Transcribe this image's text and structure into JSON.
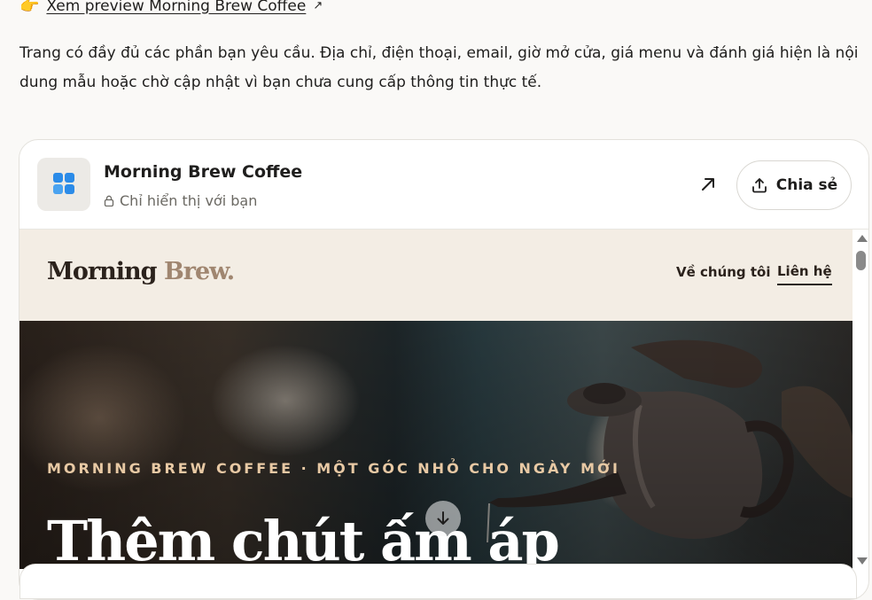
{
  "top_link": {
    "emoji": "👉",
    "text": "Xem preview Morning Brew Coffee",
    "ext_icon": "↗"
  },
  "intro": "Trang có đầy đủ các phần bạn yêu cầu. Địa chỉ, điện thoại, email, giờ mở cửa, giá menu và đánh giá hiện là nội dung mẫu hoặc chờ cập nhật vì bạn chưa cung cấp thông tin thực tế.",
  "artifact": {
    "title": "Morning Brew Coffee",
    "visibility": "Chỉ hiển thị với bạn",
    "share_label": "Chia sẻ",
    "icons": [
      "app-grid-icon",
      "lock-icon",
      "open-external-icon",
      "share-upload-icon"
    ]
  },
  "site": {
    "logo_main": "Morning",
    "logo_accent": "Brew.",
    "nav": [
      {
        "label": "Về chúng tôi",
        "active": false
      },
      {
        "label": "Liên hệ",
        "active": true
      }
    ],
    "hero": {
      "eyebrow": "MORNING BREW COFFEE · MỘT GÓC NHỎ CHO NGÀY MỚI",
      "title": "Thêm chút ấm áp"
    }
  },
  "colors": {
    "nav_bg": "#f3ede4",
    "logo_accent": "#a08670",
    "eyebrow": "#e8c9a4",
    "icon_blue": "#2b8be8"
  }
}
